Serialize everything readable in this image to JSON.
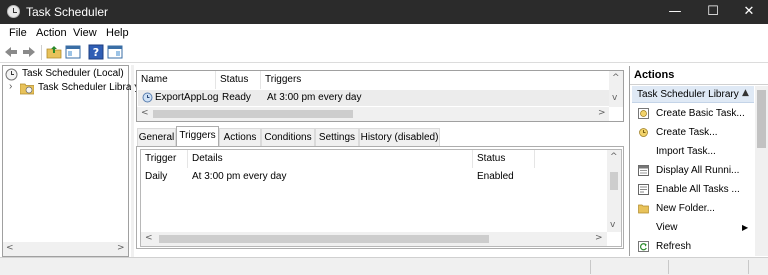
{
  "window": {
    "title": "Task Scheduler"
  },
  "menu": [
    "File",
    "Action",
    "View",
    "Help"
  ],
  "window_controls": {
    "minimize": "—",
    "maximize": "☐",
    "close": "✕"
  },
  "tree": {
    "root": "Task Scheduler (Local)",
    "child": "Task Scheduler Library",
    "expander": "›"
  },
  "task_list": {
    "columns": [
      "Name",
      "Status",
      "Triggers"
    ],
    "rows": [
      {
        "name": "ExportAppLog",
        "status": "Ready",
        "triggers": "At 3:00 pm every day"
      }
    ]
  },
  "tabs": [
    "General",
    "Triggers",
    "Actions",
    "Conditions",
    "Settings",
    "History (disabled)"
  ],
  "active_tab": "Triggers",
  "triggers_table": {
    "columns": [
      "Trigger",
      "Details",
      "Status"
    ],
    "rows": [
      {
        "trigger": "Daily",
        "details": "At 3:00 pm every day",
        "status": "Enabled"
      }
    ]
  },
  "actions_pane": {
    "title": "Actions",
    "section": "Task Scheduler Library",
    "items": [
      {
        "label": "Create Basic Task...",
        "icon": "create-basic-task-icon"
      },
      {
        "label": "Create Task...",
        "icon": "create-task-icon"
      },
      {
        "label": "Import Task...",
        "icon": ""
      },
      {
        "label": "Display All Runni...",
        "icon": "display-running-icon"
      },
      {
        "label": "Enable All Tasks ...",
        "icon": "enable-history-icon"
      },
      {
        "label": "New Folder...",
        "icon": "folder-icon"
      },
      {
        "label": "View",
        "icon": ""
      },
      {
        "label": "Refresh",
        "icon": "refresh-icon"
      }
    ]
  },
  "colors": {
    "titlebar": "#2b2b2b",
    "selection": "#dfe9f5",
    "row_highlight": "#ececec"
  }
}
